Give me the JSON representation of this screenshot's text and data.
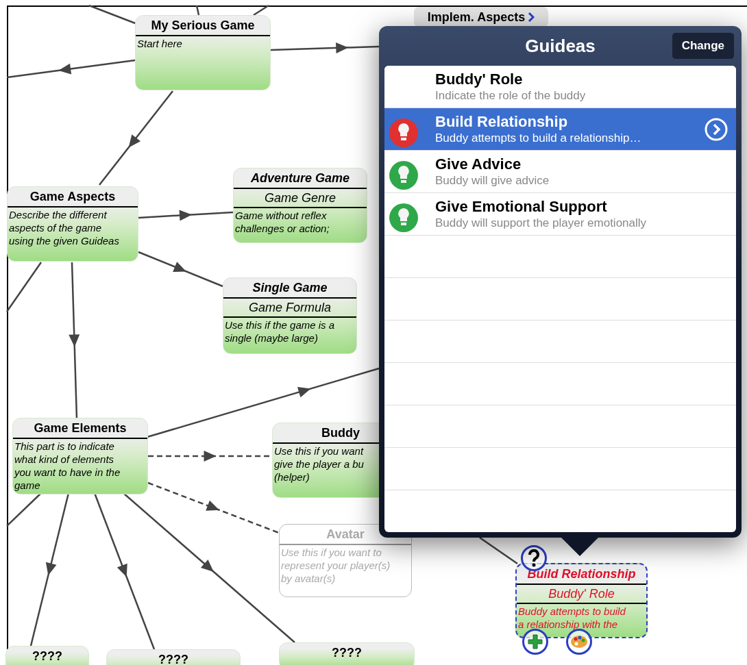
{
  "nodes": [
    {
      "kind": "topic",
      "title": "My Serious Game",
      "description": [
        "Start here"
      ],
      "selected": false,
      "disabled": false
    },
    {
      "kind": "link",
      "title": "Implem. Aspects"
    },
    {
      "kind": "topic",
      "title": "Game Aspects",
      "description": [
        "Describe the different",
        "aspects of the game",
        "using the given Guideas"
      ],
      "selected": false,
      "disabled": false
    },
    {
      "kind": "guidea",
      "title": "Adventure Game",
      "subtitle": "Game Genre",
      "description": [
        "Game without reflex",
        "challenges or action;"
      ],
      "selected": false,
      "disabled": false
    },
    {
      "kind": "guidea",
      "title": "Single Game",
      "subtitle": "Game Formula",
      "description": [
        "Use this if the game is a",
        "single (maybe large)"
      ],
      "selected": false,
      "disabled": false
    },
    {
      "kind": "topic",
      "title": "Game Elements",
      "description": [
        "This part is to indicate",
        "what kind of elements",
        "you want to have in the",
        "game"
      ],
      "selected": false,
      "disabled": false
    },
    {
      "kind": "topic",
      "title": "Buddy",
      "description": [
        "Use this if you want",
        "give the player a bu",
        "(helper)"
      ],
      "selected": false,
      "disabled": false
    },
    {
      "kind": "topic",
      "title": "Avatar",
      "description": [
        "Use this if you want to",
        "represent your player(s)",
        "by avatar(s)"
      ],
      "selected": false,
      "disabled": true
    },
    {
      "kind": "guidea",
      "title": "Build Relationship",
      "subtitle": "Buddy' Role",
      "description": [
        "Buddy attempts to build",
        "a relationship with the"
      ],
      "selected": true,
      "disabled": false
    },
    {
      "kind": "topic",
      "title": "????",
      "selected": false,
      "disabled": false
    },
    {
      "kind": "topic",
      "title": "????",
      "selected": false,
      "disabled": false
    },
    {
      "kind": "topic",
      "title": "????",
      "selected": false,
      "disabled": false
    }
  ],
  "popover": {
    "title": "Guideas",
    "button": "Change",
    "items": [
      {
        "title": "Buddy' Role",
        "description": "Indicate the role of the buddy",
        "selected": false
      },
      {
        "title": "Build Relationship",
        "description": "Buddy attempts to build a relationship…",
        "color": "#e03030",
        "selected": true
      },
      {
        "title": "Give Advice",
        "description": "Buddy will give advice",
        "color": "#2fa84a",
        "selected": false
      },
      {
        "title": "Give Emotional Support",
        "description": "Buddy will support the player emotionally",
        "color": "#2fa84a",
        "selected": false
      }
    ]
  }
}
